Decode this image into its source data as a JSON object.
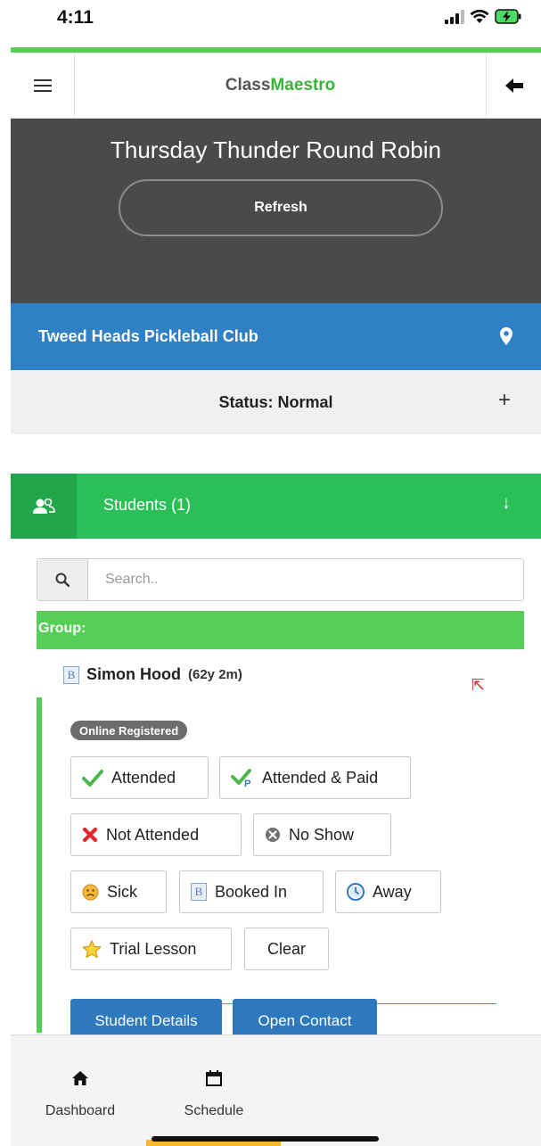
{
  "status_bar": {
    "time": "4:11"
  },
  "app": {
    "brand_part1": "Class",
    "brand_part2": "Maestro"
  },
  "class": {
    "title": "Thursday Thunder Round Robin",
    "refresh_label": "Refresh",
    "location": "Tweed Heads Pickleball Club",
    "status": "Status: Normal",
    "expand_symbol": "+"
  },
  "students_section": {
    "label": "Students (1)",
    "search_placeholder": "Search..",
    "group_label": "Group:"
  },
  "student": {
    "name": "Simon Hood",
    "age": "(62y 2m)",
    "badge": "Online Registered",
    "options": [
      "Attended",
      "Attended & Paid",
      "Not Attended",
      "No Show",
      "Sick",
      "Booked In",
      "Away",
      "Trial Lesson",
      "Clear"
    ],
    "details_button": "Student Details",
    "contact_button": "Open Contact"
  },
  "tabs": [
    {
      "label": "Dashboard",
      "icon": "home-icon"
    },
    {
      "label": "Schedule",
      "icon": "calendar-icon"
    }
  ],
  "colors": {
    "accent_green": "#58d058",
    "location_blue": "#2f80c4",
    "students_green": "#2bbf58",
    "button_blue": "#2e79be",
    "tab_indicator": "#f5b82a"
  }
}
